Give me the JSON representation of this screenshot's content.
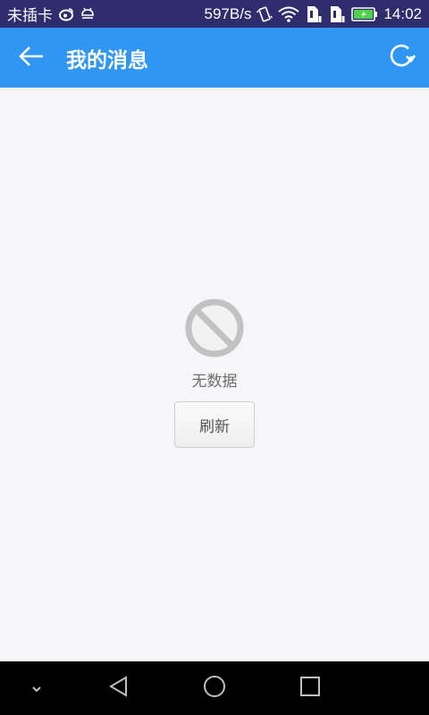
{
  "status_bar": {
    "carrier": "未插卡",
    "speed": "597B/s",
    "time": "14:02",
    "icons": [
      "weibo-icon",
      "android-debug-icon",
      "vibrate-icon",
      "wifi-icon",
      "sim1-icon",
      "sim2-icon",
      "battery-charging-icon"
    ],
    "bg_color": "#2f2d6e"
  },
  "app_bar": {
    "title": "我的消息",
    "back_icon": "arrow-left-icon",
    "refresh_icon": "refresh-icon",
    "bg_color": "#2f97f3"
  },
  "empty_state": {
    "icon": "no-data-icon",
    "message": "无数据",
    "refresh_label": "刷新"
  },
  "nav_bar": {
    "items": [
      "chevron-down-icon",
      "back-triangle-icon",
      "home-circle-icon",
      "recents-square-icon"
    ],
    "bg_color": "#000000"
  }
}
